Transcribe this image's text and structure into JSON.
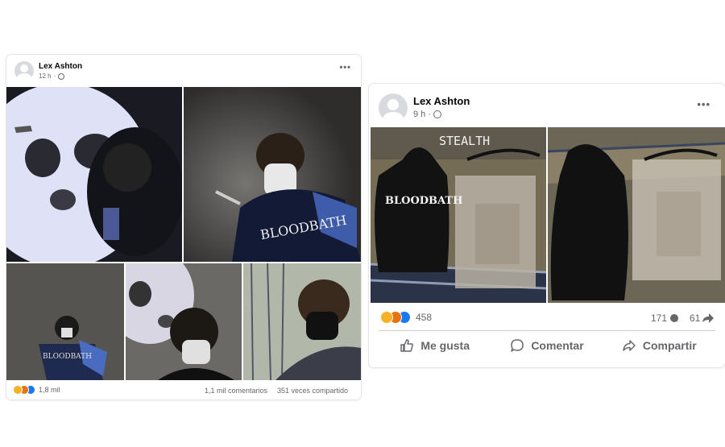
{
  "left_post": {
    "author": "Lex Ashton",
    "time": "12 h",
    "separator": "·",
    "reactions_count": "1,8 mil",
    "comments": "1,1 mil comentarios",
    "shares": "351 veces compartido",
    "photo_texts": {
      "hoodie_text_2": "BLOODBATH",
      "hoodie_text_3": "BLOODBATH"
    }
  },
  "right_post": {
    "author": "Lex Ashton",
    "time": "9 h",
    "separator": "·",
    "reactions_count": "458",
    "comments_count": "171",
    "shares_count": "61",
    "photo_texts": {
      "stealth": "STEALTH",
      "bloodbath": "BLOODBATH"
    },
    "actions": {
      "like": "Me gusta",
      "comment": "Comentar",
      "share": "Compartir"
    }
  },
  "icons": [
    "avatar-placeholder",
    "globe-icon",
    "more-options-icon",
    "haha-reaction-icon",
    "angry-reaction-icon",
    "like-reaction-icon",
    "comment-icon",
    "share-icon",
    "thumbs-up-icon",
    "speech-bubble-icon"
  ],
  "colors": {
    "text_primary": "#050505",
    "text_secondary": "#65676b",
    "like_blue": "#1877f2",
    "haha_yellow": "#f7b125",
    "angry_orange": "#e9710f",
    "divider": "#ced0d4"
  }
}
